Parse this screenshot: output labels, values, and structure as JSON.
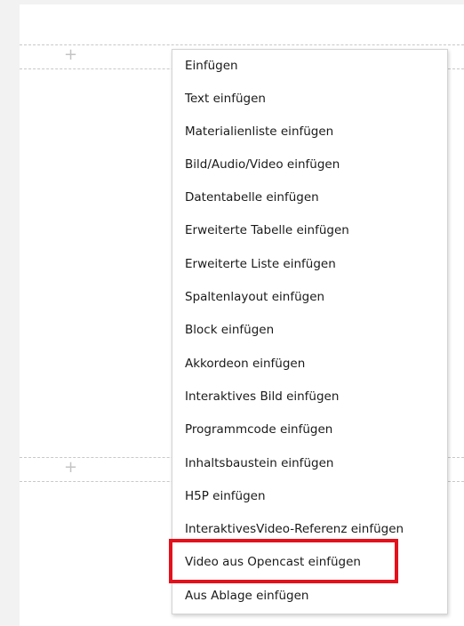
{
  "editor": {
    "insert_plus_1": "+",
    "insert_plus_2": "+"
  },
  "insert_menu": {
    "items": [
      "Einfügen",
      "Text einfügen",
      "Materialienliste einfügen",
      "Bild/Audio/Video einfügen",
      "Datentabelle einfügen",
      "Erweiterte Tabelle einfügen",
      "Erweiterte Liste einfügen",
      "Spaltenlayout einfügen",
      "Block einfügen",
      "Akkordeon einfügen",
      "Interaktives Bild einfügen",
      "Programmcode einfügen",
      "Inhaltsbaustein einfügen",
      "H5P einfügen",
      "InteraktivesVideo-Referenz einfügen",
      "Video aus Opencast einfügen",
      "Aus Ablage einfügen"
    ],
    "highlighted_item": "Video aus Opencast einfügen"
  },
  "colors": {
    "highlight_border": "#e4101b",
    "page_background": "#f2f2f2"
  }
}
